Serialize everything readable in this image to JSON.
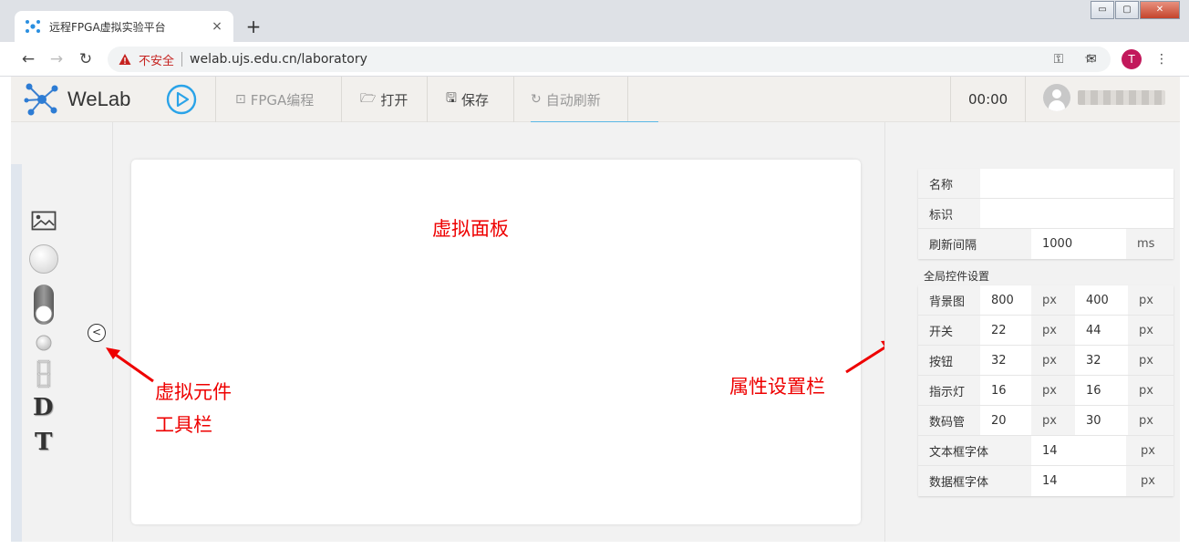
{
  "browser": {
    "tab_title": "远程FPGA虚拟实验平台",
    "tab_close": "×",
    "new_tab": "+",
    "security_label": "不安全",
    "url": "welab.ujs.edu.cn/laboratory",
    "profile_initial": "T",
    "window_controls": {
      "minimize": "▭",
      "maximize": "▢",
      "close": "✕"
    }
  },
  "header": {
    "brand": "WeLab",
    "menu": {
      "fpga": "FPGA编程",
      "open": "打开",
      "save": "保存",
      "refresh": "自动刷新"
    },
    "timer": "00:00"
  },
  "canvas": {
    "label": "虚拟面板"
  },
  "annotations": {
    "toolbar_line1": "虚拟元件",
    "toolbar_line2": "工具栏",
    "props": "属性设置栏"
  },
  "toolbar": {
    "text_d": "D",
    "text_t": "T"
  },
  "props": {
    "basic": [
      {
        "label": "名称",
        "value": ""
      },
      {
        "label": "标识",
        "value": ""
      },
      {
        "label": "刷新间隔",
        "value": "1000",
        "unit": "ms"
      }
    ],
    "section_title": "全局控件设置",
    "pairs": [
      {
        "label": "背景图",
        "v1": "800",
        "u1": "px",
        "v2": "400",
        "u2": "px"
      },
      {
        "label": "开关",
        "v1": "22",
        "u1": "px",
        "v2": "44",
        "u2": "px"
      },
      {
        "label": "按钮",
        "v1": "32",
        "u1": "px",
        "v2": "32",
        "u2": "px"
      },
      {
        "label": "指示灯",
        "v1": "16",
        "u1": "px",
        "v2": "16",
        "u2": "px"
      },
      {
        "label": "数码管",
        "v1": "20",
        "u1": "px",
        "v2": "30",
        "u2": "px"
      }
    ],
    "fonts": [
      {
        "label": "文本框字体",
        "value": "14",
        "unit": "px"
      },
      {
        "label": "数据框字体",
        "value": "14",
        "unit": "px"
      }
    ]
  },
  "colors": {
    "accent": "#2aa3e8",
    "annotation": "#e00000",
    "active_tab_bar": "#5ab8e6"
  }
}
